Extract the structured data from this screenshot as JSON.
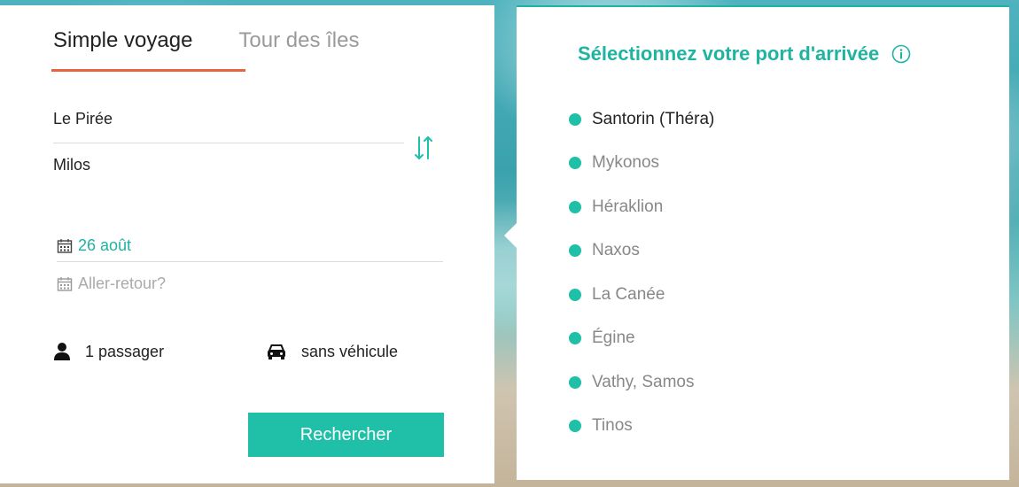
{
  "tabs": [
    {
      "label": "Simple voyage",
      "active": true
    },
    {
      "label": "Tour des îles",
      "active": false
    }
  ],
  "route": {
    "from": "Le Pirée",
    "to": "Milos"
  },
  "dates": {
    "departure": "26 août",
    "return_placeholder": "Aller-retour?"
  },
  "options": {
    "passengers": "1 passager",
    "vehicle": "sans véhicule"
  },
  "search_label": "Rechercher",
  "arrival": {
    "title": "Sélectionnez votre port d'arrivée",
    "ports": [
      "Santorin (Théra)",
      "Mykonos",
      "Héraklion",
      "Naxos",
      "La Canée",
      "Égine",
      "Vathy, Samos",
      "Tinos"
    ]
  },
  "colors": {
    "accent": "#1fbfa8",
    "tab_underline": "#e8643c"
  }
}
